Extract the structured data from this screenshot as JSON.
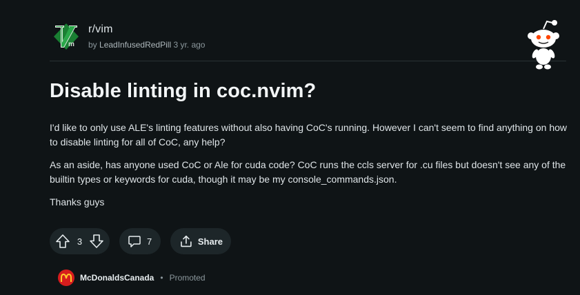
{
  "header": {
    "subreddit": "r/vim",
    "byline_prefix": "by",
    "author": "LeadInfusedRedPill",
    "age": "3 yr. ago"
  },
  "post": {
    "title": "Disable linting in coc.nvim?",
    "paragraphs": [
      "I'd like to only use ALE's linting features without also having CoC's running. However I can't seem to find anything on how to disable linting for all of CoC, any help?",
      "As an aside, has anyone used CoC or Ale for cuda code? CoC runs the ccls server for .cu files but doesn't see any of the builtin types or keywords for cuda, though it may be my console_commands.json.",
      "Thanks guys"
    ]
  },
  "actions": {
    "score": "3",
    "comments": "7",
    "share_label": "Share"
  },
  "promoted": {
    "advertiser": "McDonaldsCanada",
    "separator": "•",
    "label": "Promoted"
  },
  "icons": {
    "subreddit": "vim-logo-icon",
    "mascot": "snoo-icon",
    "upvote": "arrow-up-icon",
    "downvote": "arrow-down-icon",
    "comment": "comment-bubble-icon",
    "share": "share-icon",
    "advertiser": "mcdonalds-logo-icon"
  },
  "colors": {
    "background": "#0f1416",
    "pill": "#1d2629",
    "vim_green": "#1f9c3c",
    "mcdonalds_red": "#d61d1d",
    "mcdonalds_yellow": "#ffc72c"
  }
}
